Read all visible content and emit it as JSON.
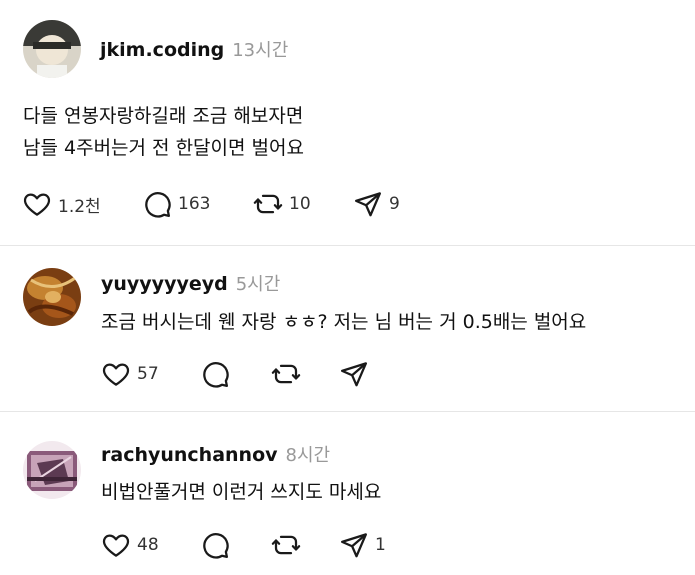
{
  "posts": [
    {
      "username": "jkim.coding",
      "time": "13시간",
      "lines": [
        "다들 연봉자랑하길래 조금 해보자면",
        "남들 4주버는거 전 한달이면 벌어요"
      ],
      "likes": "1.2천",
      "comments": "163",
      "reposts": "10",
      "shares": "9"
    },
    {
      "username": "yuyyyyyeyd",
      "time": "5시간",
      "lines": [
        "조금 버시는데 웬 자랑 ㅎㅎ? 저는 님 버는 거 0.5배는 벌어요"
      ],
      "likes": "57",
      "comments": "",
      "reposts": "",
      "shares": ""
    },
    {
      "username": "rachyunchannov",
      "time": "8시간",
      "lines": [
        "비법안풀거면 이런거 쓰지도 마세요"
      ],
      "likes": "48",
      "comments": "",
      "reposts": "",
      "shares": "1"
    }
  ],
  "icons": {
    "like": "heart-icon",
    "comment": "speech-bubble-icon",
    "repost": "repost-arrows-icon",
    "share": "paper-plane-icon"
  }
}
